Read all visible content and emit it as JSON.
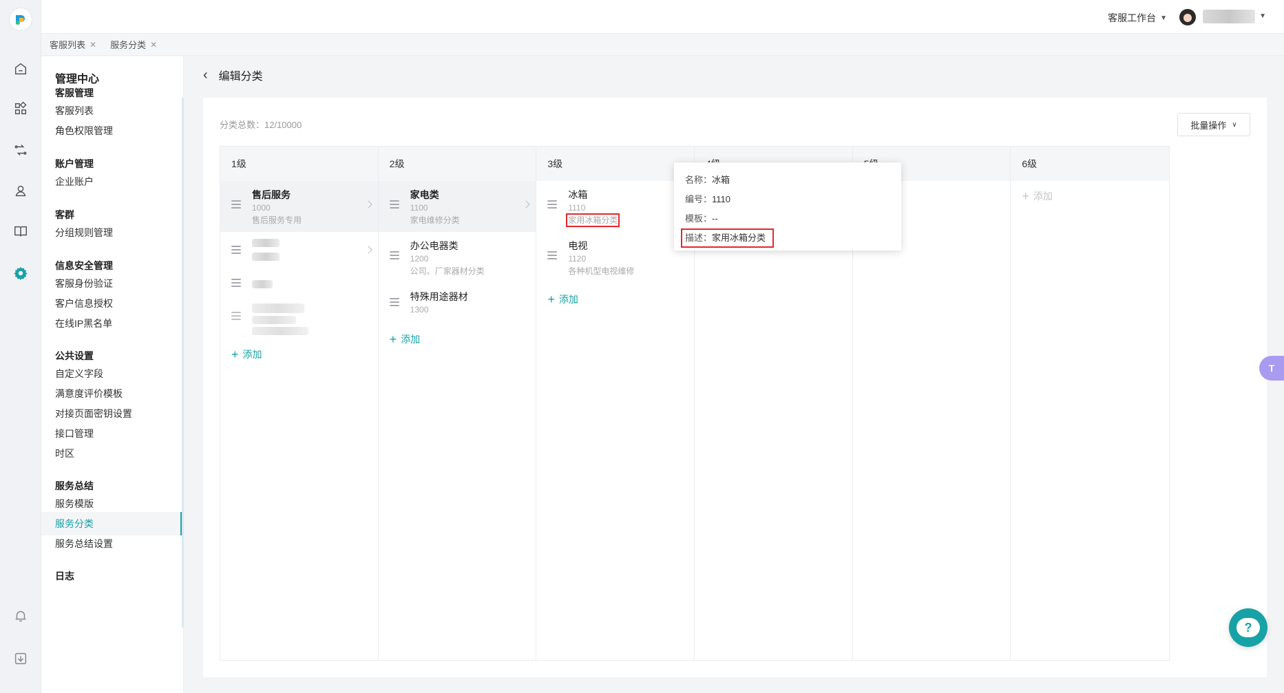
{
  "colors": {
    "accent": "#17a2a6",
    "highlight_box": "#e5262a"
  },
  "topbar": {
    "workbench_label": "客服工作台"
  },
  "tabs": [
    {
      "label": "客服列表"
    },
    {
      "label": "服务分类"
    }
  ],
  "sidebar": {
    "title": "管理中心",
    "groups": [
      {
        "title": "客服管理",
        "items": [
          "客服列表",
          "角色权限管理"
        ]
      },
      {
        "title": "账户管理",
        "items": [
          "企业账户"
        ]
      },
      {
        "title": "客群",
        "items": [
          "分组规则管理"
        ]
      },
      {
        "title": "信息安全管理",
        "items": [
          "客服身份验证",
          "客户信息授权",
          "在线IP黑名单"
        ]
      },
      {
        "title": "公共设置",
        "items": [
          "自定义字段",
          "满意度评价模板",
          "对接页面密钥设置",
          "接口管理",
          "时区"
        ]
      },
      {
        "title": "服务总结",
        "items": [
          "服务模版",
          "服务分类",
          "服务总结设置"
        ]
      },
      {
        "title": "日志",
        "items": []
      }
    ],
    "active_item": "服务分类"
  },
  "page": {
    "title": "编辑分类",
    "count_text": "分类总数：12/10000",
    "bulk_button": "批量操作"
  },
  "columns": [
    {
      "label": "1级"
    },
    {
      "label": "2级"
    },
    {
      "label": "3级"
    },
    {
      "label": "4级"
    },
    {
      "label": "5级"
    },
    {
      "label": "6级"
    }
  ],
  "level1": [
    {
      "name": "售后服务",
      "code": "1000",
      "desc": "售后服务专用"
    }
  ],
  "level2": [
    {
      "name": "家电类",
      "code": "1100",
      "desc": "家电维修分类"
    },
    {
      "name": "办公电器类",
      "code": "1200",
      "desc": "公司、厂家器材分类"
    },
    {
      "name": "特殊用途器材",
      "code": "1300",
      "desc": ""
    }
  ],
  "level3": [
    {
      "name": "冰箱",
      "code": "1110",
      "desc": "家用冰箱分类"
    },
    {
      "name": "电视",
      "code": "1120",
      "desc": "各种机型电视维修"
    }
  ],
  "add_label": "添加",
  "popover": {
    "name_key": "名称：",
    "name_val": "冰箱",
    "code_key": "编号：",
    "code_val": "1110",
    "template_key": "模板：",
    "template_val": "--",
    "desc_key": "描述：",
    "desc_val": "家用冰箱分类"
  }
}
